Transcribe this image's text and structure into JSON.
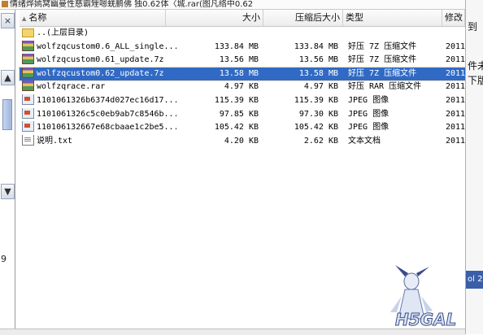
{
  "window": {
    "title": "情绪烨嫣窝幽曼性慈霸矬嗯蜣鹏佛  独0.62体〈城.rar(图凡络中0.62"
  },
  "leftpane": {
    "close_label": "×",
    "collapse_label": "▲",
    "expand_label": "▼",
    "edge_char": "9"
  },
  "columns": {
    "name": "名称",
    "size": "大小",
    "compressed": "压缩后大小",
    "type": "类型",
    "modified": "修改"
  },
  "files": [
    {
      "icon": "folder-icon",
      "kind": "folder",
      "name": "..(上层目录)",
      "size": "",
      "compressed": "",
      "type": "",
      "modified": "",
      "selected": false
    },
    {
      "icon": "archive-icon",
      "kind": "archive",
      "name": "wolfzqcustom0.6_ALL_single...",
      "size": "133.84 MB",
      "compressed": "133.84 MB",
      "type": "好压 7Z 压缩文件",
      "modified": "2011",
      "selected": false
    },
    {
      "icon": "archive-icon",
      "kind": "archive",
      "name": "wolfzqcustom0.61_update.7z",
      "size": "13.56 MB",
      "compressed": "13.56 MB",
      "type": "好压 7Z 压缩文件",
      "modified": "2011",
      "selected": false
    },
    {
      "icon": "archive-icon",
      "kind": "archive",
      "name": "wolfzqcustom0.62_update.7z",
      "size": "13.58 MB",
      "compressed": "13.58 MB",
      "type": "好压 7Z 压缩文件",
      "modified": "2011",
      "selected": true
    },
    {
      "icon": "archive-icon",
      "kind": "archive",
      "name": "wolfzqrace.rar",
      "size": "4.97 KB",
      "compressed": "4.97 KB",
      "type": "好压 RAR 压缩文件",
      "modified": "2011",
      "selected": false
    },
    {
      "icon": "image-icon",
      "kind": "image",
      "name": "1101061326b6374d027ec16d17...",
      "size": "115.39 KB",
      "compressed": "115.39 KB",
      "type": "JPEG 图像",
      "modified": "2011",
      "selected": false
    },
    {
      "icon": "image-icon",
      "kind": "image",
      "name": "1101061326c5c0eb9ab7c8546b...",
      "size": "97.85 KB",
      "compressed": "97.30 KB",
      "type": "JPEG 图像",
      "modified": "2011",
      "selected": false
    },
    {
      "icon": "image-icon",
      "kind": "image",
      "name": "110106132667e68cbaae1c2be5...",
      "size": "105.42 KB",
      "compressed": "105.42 KB",
      "type": "JPEG 图像",
      "modified": "2011",
      "selected": false
    },
    {
      "icon": "text-file-icon",
      "kind": "text",
      "name": "说明.txt",
      "size": "4.20 KB",
      "compressed": "2.62 KB",
      "type": "文本文档",
      "modified": "2011",
      "selected": false
    }
  ],
  "rightstrip": {
    "line1": "到",
    "line2": "件未",
    "line3": "下版",
    "bar_text": "ol 2"
  },
  "watermark": {
    "text": "H5GAL"
  },
  "colors": {
    "selection": "#316ac5",
    "header_bg": "#ececec"
  }
}
